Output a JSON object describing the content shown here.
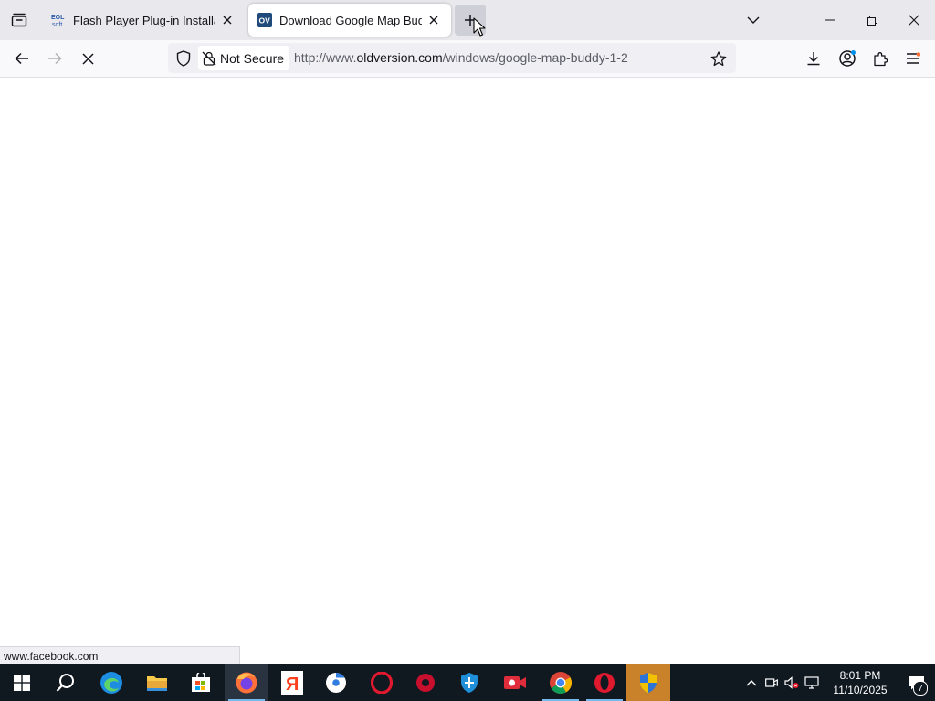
{
  "tabs": [
    {
      "favicon_text": "EOL\nsoft",
      "title": "Flash Player Plug-in Installation",
      "active": false
    },
    {
      "favicon_text": "OV",
      "title": "Download Google Map Buddy",
      "active": true
    }
  ],
  "nav": {
    "security_label": "Not Secure",
    "url_prefix": "http://www.",
    "url_domain": "oldversion.com",
    "url_path": "/windows/google-map-buddy-1-2"
  },
  "status_bar": {
    "link": "www.facebook.com"
  },
  "taskbar": {
    "time": "8:01 PM",
    "date": "11/10/2025",
    "notification_count": "7"
  },
  "colors": {
    "tabstrip": "#e8e8ed",
    "navbar": "#f9f9fb",
    "taskbar": "#101820",
    "ov_favicon": "#1f4a7a",
    "firefox_accent": "#ff7139"
  }
}
